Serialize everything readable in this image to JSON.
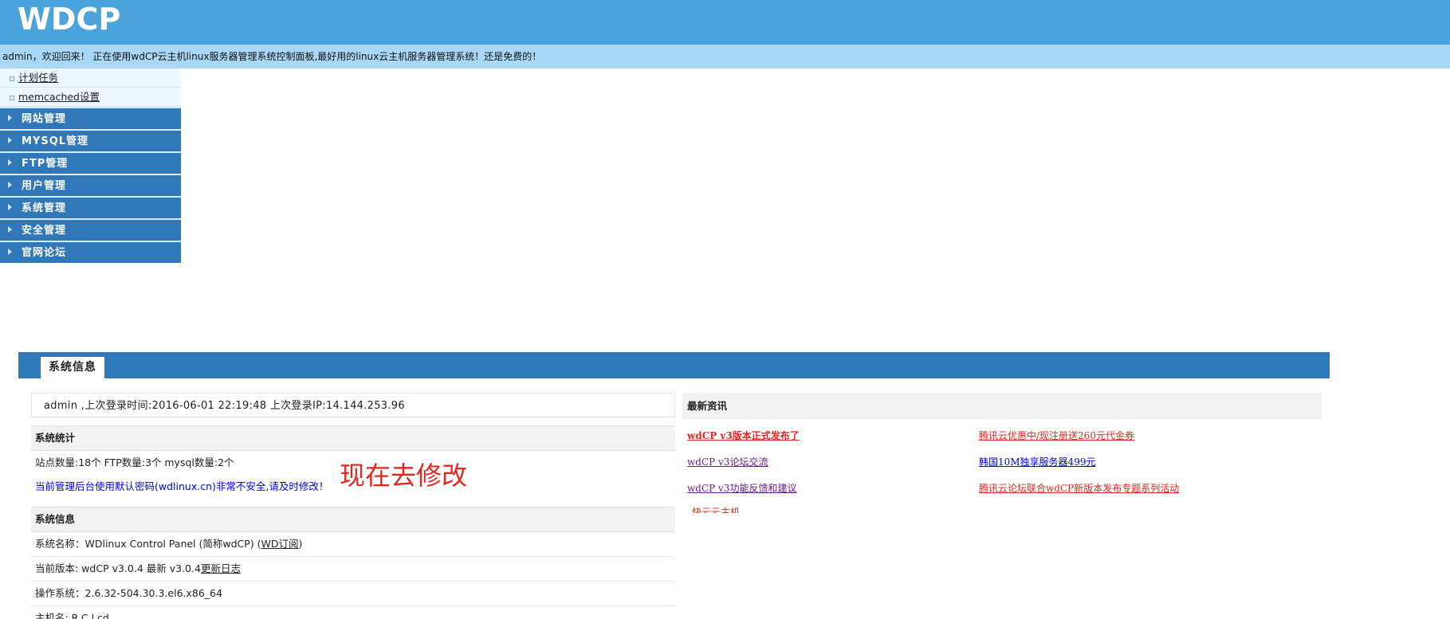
{
  "header": {
    "logo": "WDCP"
  },
  "welcome": "admin，欢迎回来！ 正在使用wdCP云主机linux服务器管理系统控制面板,最好用的linux云主机服务器管理系统！还是免费的！",
  "sidebar": {
    "sub_items": [
      "计划任务",
      "memcached设置"
    ],
    "menu": [
      "网站管理",
      "MYSQL管理",
      "FTP管理",
      "用户管理",
      "系统管理",
      "安全管理",
      "官网论坛"
    ]
  },
  "panel": {
    "tab": "系统信息"
  },
  "left": {
    "last_login": "admin ,上次登录时间:2016-06-01 22:19:48 上次登录IP:14.144.253.96",
    "stats_title": "系统统计",
    "stats_row": "站点数量:18个   FTP数量:3个   mysql数量:2个",
    "warning": "当前管理后台使用默认密码(wdlinux.cn)非常不安全,请及时修改！",
    "warning_action": "现在去修改",
    "info_title": "系统信息",
    "sys_name_label": "系统名称：WDlinux Control Panel (简称wdCP) (",
    "sys_name_link": "WD订阅",
    "sys_name_end": ")",
    "version_label": "当前版本: wdCP v3.0.4 最新 v3.0.4",
    "version_link": "更新日志",
    "os": "操作系统：2.6.32-504.30.3.el6.x86_64",
    "partial_row": "主机名: R.C.l.cd..."
  },
  "right": {
    "news_title": "最新资讯",
    "news": [
      {
        "text": "wdCP v3版本正式发布了",
        "color": "red",
        "bold": true
      },
      {
        "text": "腾讯云优惠中/现注册送260元代金券",
        "color": "red",
        "bold": false
      },
      {
        "text": "wdCP v3论坛交流",
        "color": "purple",
        "bold": false
      },
      {
        "text": "韩国10M独享服务器499元",
        "color": "blue",
        "bold": false
      },
      {
        "text": "wdCP v3功能反馈和建议",
        "color": "purple",
        "bold": false
      },
      {
        "text": "腾讯云论坛联合wdCP新版本发布专题系列活动",
        "color": "red",
        "bold": false
      },
      {
        "text": "快云云主机",
        "color": "red",
        "bold": false
      }
    ]
  }
}
